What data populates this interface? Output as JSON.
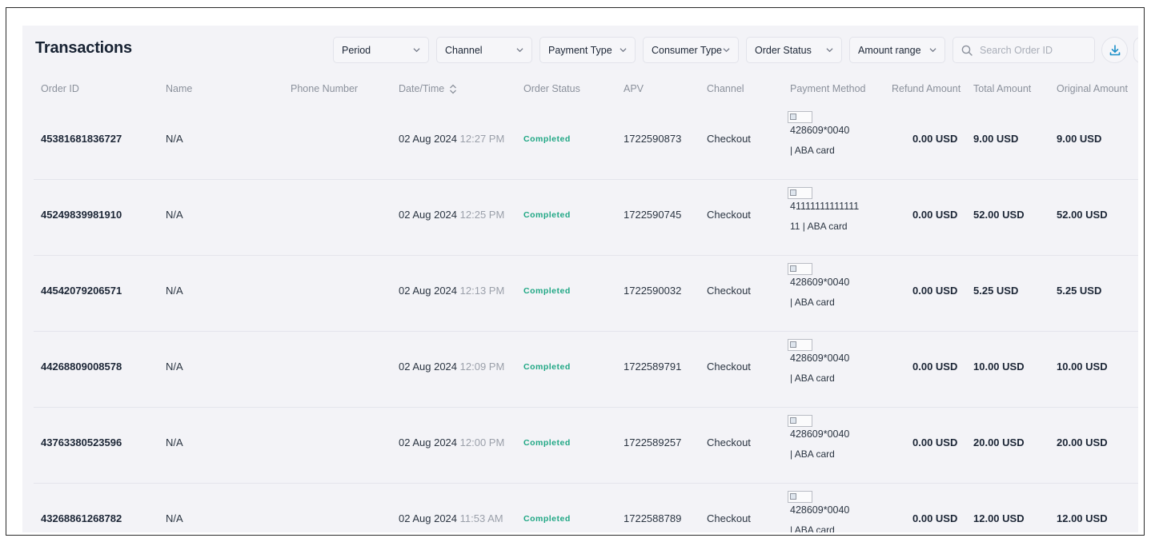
{
  "page": {
    "title": "Transactions"
  },
  "filters": [
    {
      "label": "Period"
    },
    {
      "label": "Channel"
    },
    {
      "label": "Payment Type"
    },
    {
      "label": "Consumer Type"
    },
    {
      "label": "Order Status"
    },
    {
      "label": "Amount range"
    }
  ],
  "search": {
    "placeholder": "Search Order ID",
    "value": ""
  },
  "icons": {
    "search": "search-icon",
    "download": "download-icon",
    "sort": "sort-icon",
    "chevron": "chevron-down-icon",
    "broken_image": "broken-image-icon"
  },
  "colors": {
    "status_completed": "#1fa784",
    "accent": "#1b8fc8"
  },
  "columns": [
    "Order ID",
    "Name",
    "Phone Number",
    "Date/Time",
    "Order Status",
    "APV",
    "Channel",
    "Payment Method",
    "Refund Amount",
    "Total Amount",
    "Original Amount"
  ],
  "rows": [
    {
      "order_id": "45381681836727",
      "name": "N/A",
      "phone": "",
      "date": "02 Aug 2024",
      "time": "12:27 PM",
      "status": "Completed",
      "apv": "1722590873",
      "channel": "Checkout",
      "pm_line1": "428609*0040",
      "pm_line2": "| ABA card",
      "refund": "0.00 USD",
      "total": "9.00 USD",
      "original": "9.00 USD"
    },
    {
      "order_id": "45249839981910",
      "name": "N/A",
      "phone": "",
      "date": "02 Aug 2024",
      "time": "12:25 PM",
      "status": "Completed",
      "apv": "1722590745",
      "channel": "Checkout",
      "pm_line1": "41111111111111",
      "pm_line2": "11 | ABA card",
      "refund": "0.00 USD",
      "total": "52.00 USD",
      "original": "52.00 USD"
    },
    {
      "order_id": "44542079206571",
      "name": "N/A",
      "phone": "",
      "date": "02 Aug 2024",
      "time": "12:13 PM",
      "status": "Completed",
      "apv": "1722590032",
      "channel": "Checkout",
      "pm_line1": "428609*0040",
      "pm_line2": "| ABA card",
      "refund": "0.00 USD",
      "total": "5.25 USD",
      "original": "5.25 USD"
    },
    {
      "order_id": "44268809008578",
      "name": "N/A",
      "phone": "",
      "date": "02 Aug 2024",
      "time": "12:09 PM",
      "status": "Completed",
      "apv": "1722589791",
      "channel": "Checkout",
      "pm_line1": "428609*0040",
      "pm_line2": "| ABA card",
      "refund": "0.00 USD",
      "total": "10.00 USD",
      "original": "10.00 USD"
    },
    {
      "order_id": "43763380523596",
      "name": "N/A",
      "phone": "",
      "date": "02 Aug 2024",
      "time": "12:00 PM",
      "status": "Completed",
      "apv": "1722589257",
      "channel": "Checkout",
      "pm_line1": "428609*0040",
      "pm_line2": "| ABA card",
      "refund": "0.00 USD",
      "total": "20.00 USD",
      "original": "20.00 USD"
    },
    {
      "order_id": "43268861268782",
      "name": "N/A",
      "phone": "",
      "date": "02 Aug 2024",
      "time": "11:53 AM",
      "status": "Completed",
      "apv": "1722588789",
      "channel": "Checkout",
      "pm_line1": "428609*0040",
      "pm_line2": "| ABA card",
      "refund": "0.00 USD",
      "total": "12.00 USD",
      "original": "12.00 USD"
    }
  ]
}
